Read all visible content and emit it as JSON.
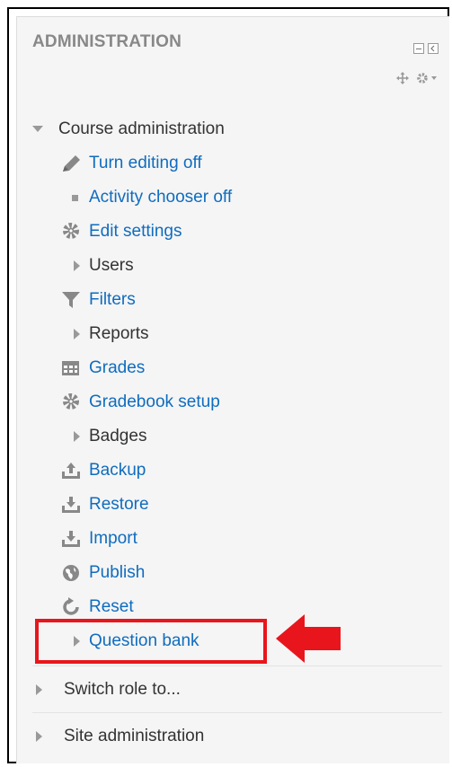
{
  "block": {
    "title": "ADMINISTRATION",
    "colors": {
      "link": "#0f6cbf",
      "text": "#333333",
      "heading": "#888888",
      "accent": "#e8161c"
    }
  },
  "course_admin": {
    "label": "Course administration",
    "items": [
      {
        "label": "Turn editing off",
        "icon": "pencil-icon",
        "link": true
      },
      {
        "label": "Activity chooser off",
        "icon": "bullet-icon",
        "link": true
      },
      {
        "label": "Edit settings",
        "icon": "gear-icon",
        "link": true
      },
      {
        "label": "Users",
        "icon": "expand-icon",
        "link": false
      },
      {
        "label": "Filters",
        "icon": "filter-icon",
        "link": true
      },
      {
        "label": "Reports",
        "icon": "expand-icon",
        "link": false
      },
      {
        "label": "Grades",
        "icon": "table-icon",
        "link": true
      },
      {
        "label": "Gradebook setup",
        "icon": "gear-icon",
        "link": true
      },
      {
        "label": "Badges",
        "icon": "expand-icon",
        "link": false
      },
      {
        "label": "Backup",
        "icon": "upload-icon",
        "link": true
      },
      {
        "label": "Restore",
        "icon": "download-icon",
        "link": true
      },
      {
        "label": "Import",
        "icon": "download-icon",
        "link": true
      },
      {
        "label": "Publish",
        "icon": "globe-icon",
        "link": true
      },
      {
        "label": "Reset",
        "icon": "reset-icon",
        "link": true
      },
      {
        "label": "Question bank",
        "icon": "expand-icon",
        "link": true
      }
    ]
  },
  "switch_role": {
    "label": "Switch role to..."
  },
  "site_admin": {
    "label": "Site administration"
  }
}
